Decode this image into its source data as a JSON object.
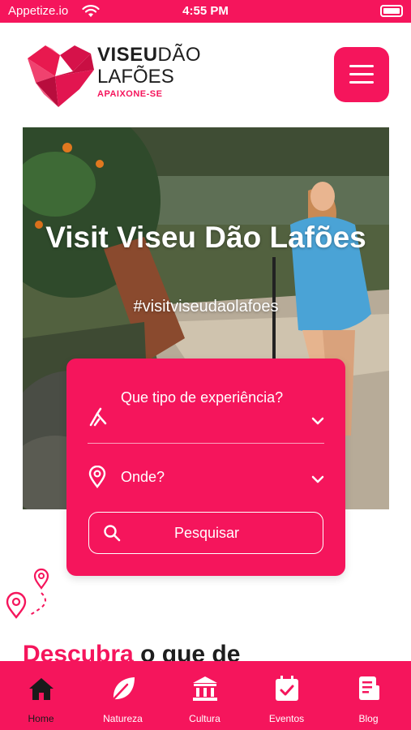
{
  "status_bar": {
    "carrier": "Appetize.io",
    "time": "4:55 PM",
    "wifi_icon": "wifi-icon",
    "battery_icon": "battery-full-icon"
  },
  "brand": {
    "logo_line1_strong": "VISEU",
    "logo_line1_light": "DÃO",
    "logo_line2": "LAFÕES",
    "tagline": "APAIXONE-SE",
    "accent_color": "#f5155c"
  },
  "header": {
    "menu_icon": "hamburger-menu-icon"
  },
  "hero": {
    "title": "Visit Viseu Dão Lafões",
    "hashtag": "#visitviseudaolafoes"
  },
  "search": {
    "experience_label": "Que tipo de experiência?",
    "experience_icon": "hiking-icon",
    "where_label": "Onde?",
    "where_icon": "location-pin-icon",
    "button_label": "Pesquisar",
    "button_icon": "search-icon"
  },
  "section": {
    "heading_accent": "Descubra",
    "heading_rest": "o que de"
  },
  "bottom_nav": {
    "items": [
      {
        "label": "Home",
        "icon": "home-icon",
        "active": true
      },
      {
        "label": "Natureza",
        "icon": "leaf-icon",
        "active": false
      },
      {
        "label": "Cultura",
        "icon": "museum-icon",
        "active": false
      },
      {
        "label": "Eventos",
        "icon": "calendar-check-icon",
        "active": false
      },
      {
        "label": "Blog",
        "icon": "document-icon",
        "active": false
      }
    ]
  }
}
